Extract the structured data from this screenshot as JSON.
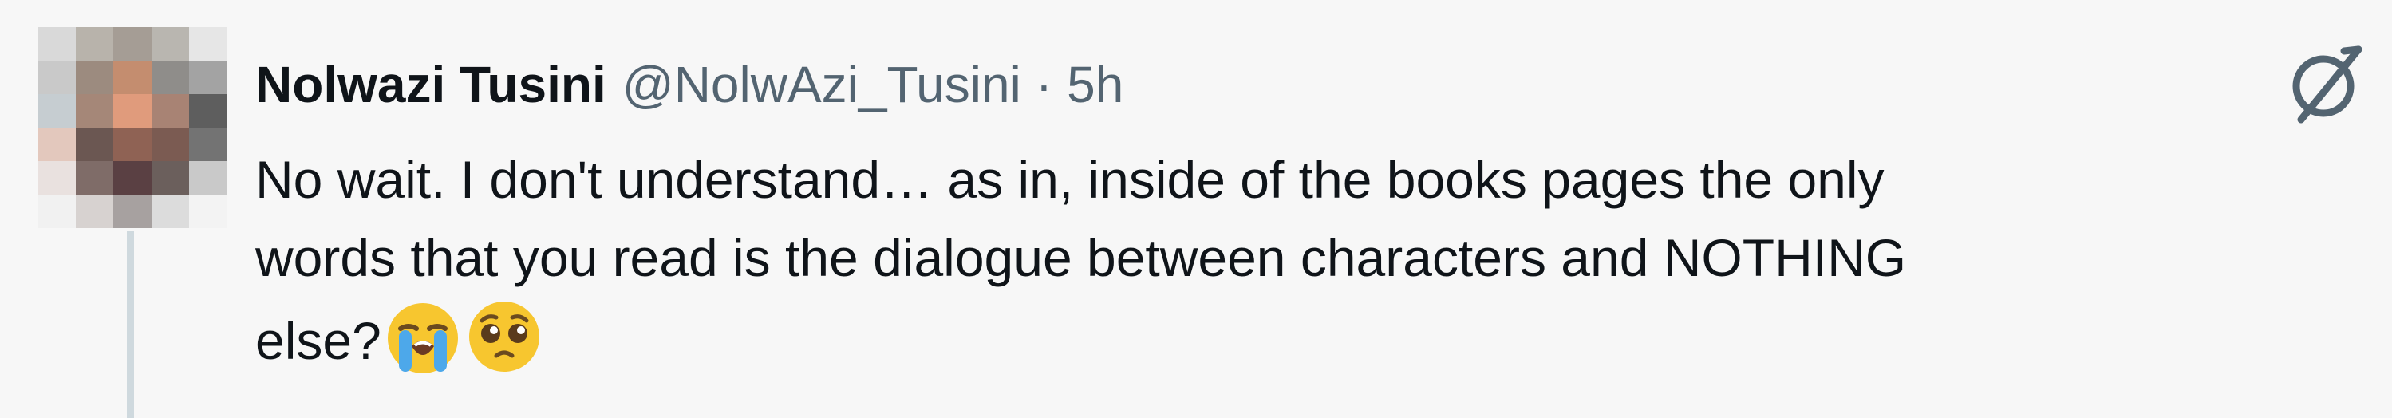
{
  "author": {
    "name": "Nolwazi Tusini",
    "handle": "@NolwAzi_Tusini",
    "separator": "·",
    "time": "5h"
  },
  "icons": {
    "top_right": "grok-slash-icon",
    "emoji_1": "loudly-crying-face-emoji",
    "emoji_2": "pleading-face-emoji"
  },
  "tweet": {
    "lines": [
      "No wait. I don't understand… as in, inside of the books pages the only",
      "words that you read is the dialogue between characters and NOTHING",
      "else?"
    ]
  },
  "colors": {
    "background": "#f7f7f7",
    "text": "#0f1419",
    "secondary_text": "#536471",
    "thread_line": "#cfd9de"
  }
}
